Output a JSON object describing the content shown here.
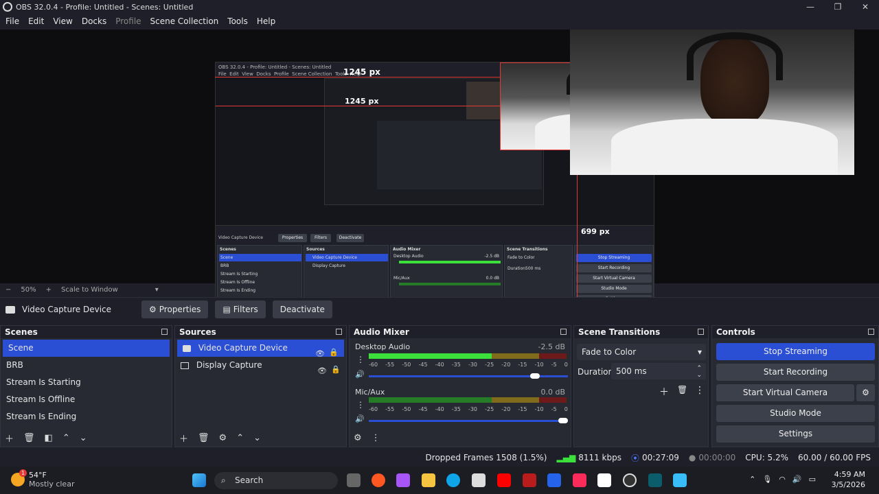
{
  "window": {
    "title": "OBS 32.0.4 - Profile: Untitled - Scenes: Untitled",
    "controls": [
      "—",
      "❐",
      "✕"
    ]
  },
  "menu": [
    "File",
    "Edit",
    "View",
    "Docks",
    "Profile",
    "Scene Collection",
    "Tools",
    "Help"
  ],
  "preview": {
    "width_label": "1245 px",
    "height_label": "699 px",
    "nested_width_label": "1245 px",
    "nested_title": "OBS 32.0.4 - Profile: Untitled - Scenes: Untitled",
    "nested_menu": [
      "File",
      "Edit",
      "View",
      "Docks",
      "Profile",
      "Scene Collection",
      "Tools",
      "Help"
    ],
    "nested_source": "Video Capture Device",
    "nested_buttons": [
      "Properties",
      "Filters",
      "Deactivate"
    ],
    "nested_zoom": "50%",
    "nested_scale": "Scale to Window",
    "nested_scenes_title": "Scenes",
    "nested_scenes": [
      "Scene",
      "BRB",
      "Stream Is Starting",
      "Stream Is Offline",
      "Stream Is Ending"
    ],
    "nested_sources_title": "Sources",
    "nested_sources": [
      "Video Capture Device",
      "Display Capture"
    ],
    "nested_mixer_title": "Audio Mixer",
    "nested_mixer_ch1": "Desktop Audio",
    "nested_mixer_db1": "-2.5 dB",
    "nested_mixer_ch2": "Mic/Aux",
    "nested_mixer_db2": "0.0 dB",
    "nested_transitions_title": "Scene Transitions",
    "nested_transition": "Fade to Color",
    "nested_duration_label": "Duration",
    "nested_duration": "500 ms",
    "nested_controls": [
      "Stop Streaming",
      "Start Recording",
      "Start Virtual Camera",
      "Studio Mode",
      "Settings"
    ],
    "nested_status": "Dropped Frames 1508 (1.5%)   8111 kbps   00:27:09   00:00:00   CPU: 5.2%   60.00 / 60.00 FPS",
    "nested_weather_temp": "54°F",
    "nested_weather_desc": "Mostly clear",
    "nested_search": "Search",
    "nested_time": "4:59 AM",
    "nested_date": "3/5/2026"
  },
  "scalebar": {
    "minus": "−",
    "zoom": "50%",
    "plus": "+",
    "scale_mode": "Scale to Window",
    "dropdown": "▾"
  },
  "sourcebar": {
    "source_name": "Video Capture Device",
    "properties": "Properties",
    "filters": "Filters",
    "deactivate": "Deactivate"
  },
  "scenes": {
    "title": "Scenes",
    "items": [
      "Scene",
      "BRB",
      "Stream Is Starting",
      "Stream Is Offline",
      "Stream Is Ending"
    ],
    "selected": 0
  },
  "sources": {
    "title": "Sources",
    "items": [
      "Video Capture Device",
      "Display Capture"
    ]
  },
  "mixer": {
    "title": "Audio Mixer",
    "channels": [
      {
        "name": "Desktop Audio",
        "db": "-2.5 dB",
        "volume": 0.86
      },
      {
        "name": "Mic/Aux",
        "db": "0.0 dB",
        "volume": 1.0
      }
    ],
    "scale": [
      "-60",
      "-55",
      "-50",
      "-45",
      "-40",
      "-35",
      "-30",
      "-25",
      "-20",
      "-15",
      "-10",
      "-5",
      "0"
    ]
  },
  "transitions": {
    "title": "Scene Transitions",
    "selected": "Fade to Color",
    "duration_label": "Duration",
    "duration": "500 ms"
  },
  "controls": {
    "title": "Controls",
    "stop_streaming": "Stop Streaming",
    "start_recording": "Start Recording",
    "start_virtual_camera": "Start Virtual Camera",
    "studio_mode": "Studio Mode",
    "settings": "Settings"
  },
  "status": {
    "dropped": "Dropped Frames 1508 (1.5%)",
    "bitrate": "8111 kbps",
    "stream_time": "00:27:09",
    "rec_time": "00:00:00",
    "cpu": "CPU: 5.2%",
    "fps": "60.00 / 60.00 FPS"
  },
  "taskbar": {
    "weather_badge": "1",
    "weather_temp": "54°F",
    "weather_desc": "Mostly clear",
    "search": "Search",
    "time": "4:59 AM",
    "date": "3/5/2026"
  },
  "colors": {
    "accent": "#2b4fd4",
    "background": "#1e1f29",
    "dock": "#272a33",
    "meter_green": "#3be03b",
    "marker_red": "#e53935"
  }
}
